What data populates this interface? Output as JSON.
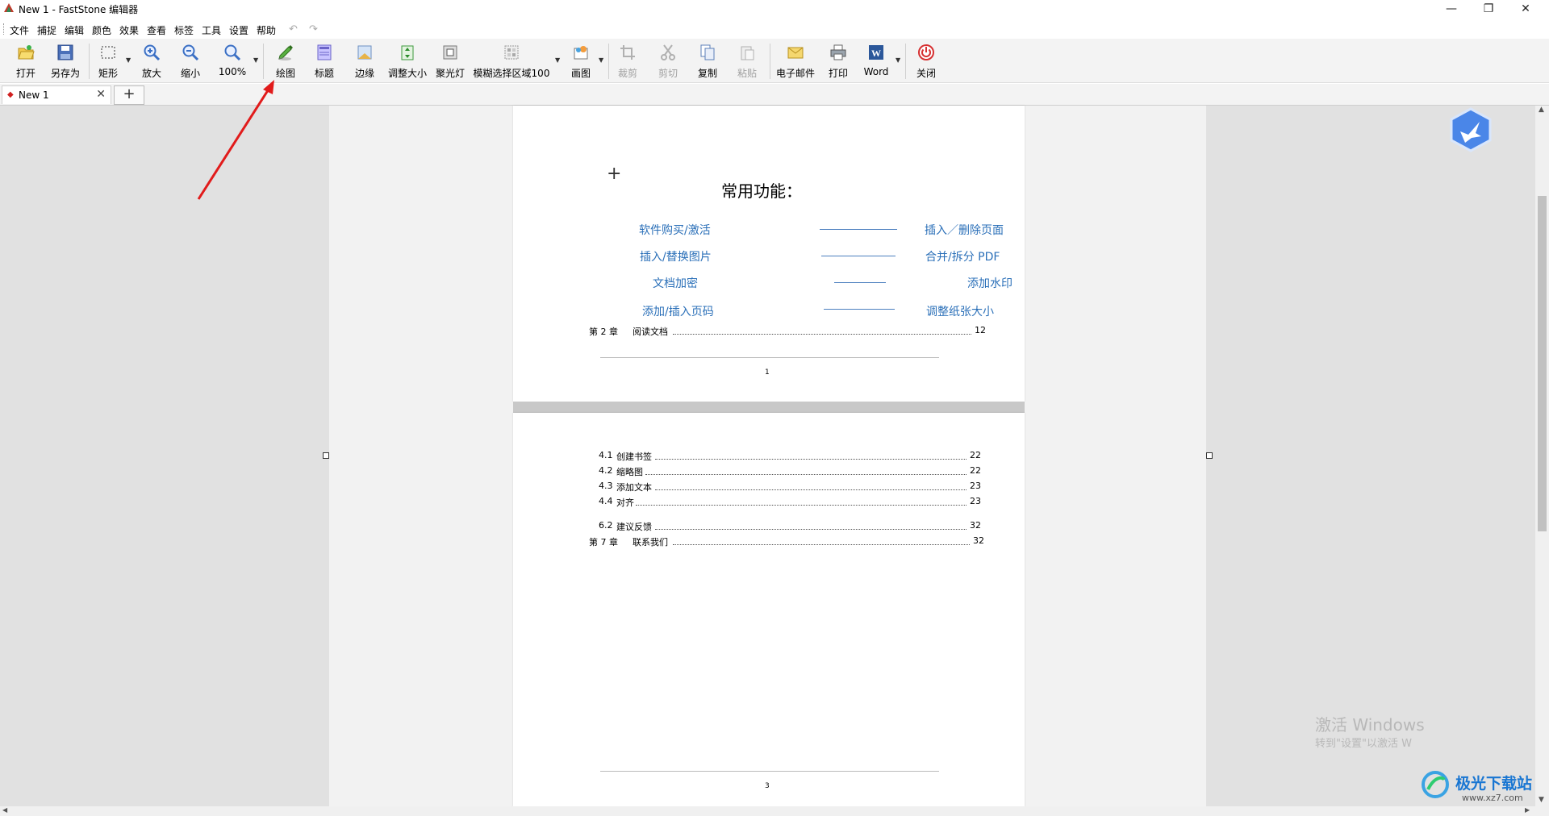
{
  "window": {
    "title": "New 1 - FastStone 编辑器",
    "minimize_icon": "minimize-icon",
    "restore_icon": "restore-icon",
    "close_icon": "close-icon"
  },
  "menu": [
    "文件",
    "捕捉",
    "编辑",
    "颜色",
    "效果",
    "查看",
    "标签",
    "工具",
    "设置",
    "帮助"
  ],
  "toolbar": {
    "open": "打开",
    "save_as": "另存为",
    "rect": "矩形",
    "zoom_in": "放大",
    "zoom_out": "缩小",
    "zoom_level": "100%",
    "draw": "绘图",
    "caption": "标题",
    "edge": "边缘",
    "resize": "调整大小",
    "spotlight": "聚光灯",
    "blur": "模糊选择区域100",
    "canvas": "画图",
    "crop": "裁剪",
    "cut": "剪切",
    "copy": "复制",
    "paste": "粘贴",
    "email": "电子邮件",
    "print": "打印",
    "word": "Word",
    "close": "关闭"
  },
  "tabs": [
    {
      "label": "New 1"
    }
  ],
  "page1": {
    "heading": "常用功能：",
    "left_links": [
      "软件购买/激活",
      "插入/替换图片",
      "文档加密",
      "添加/插入页码"
    ],
    "right_links": [
      "插入／删除页面",
      "合并/拆分  PDF",
      "添加水印",
      "调整纸张大小"
    ],
    "toc": {
      "num": "第 2 章",
      "title": "阅读文档",
      "page": "12"
    },
    "page_num": "1"
  },
  "page3": {
    "toc": [
      {
        "num": "4.1",
        "title": "创建书签",
        "page": "22"
      },
      {
        "num": "4.2",
        "title": "缩略图",
        "page": "22"
      },
      {
        "num": "4.3",
        "title": "添加文本",
        "page": "23"
      },
      {
        "num": "4.4",
        "title": "对齐",
        "page": "23"
      },
      {
        "num": "6.2",
        "title": "建议反馈",
        "page": "32"
      }
    ],
    "chapter": {
      "num": "第 7 章",
      "title": "联系我们",
      "page": "32"
    },
    "page_num": "3"
  },
  "watermark": {
    "line1": "激活 Windows",
    "line2": "转到\"设置\"以激活 W",
    "site": "极光下载站",
    "url": "www.xz7.com"
  },
  "colors": {
    "toolbar_bg": "#f3f3f3",
    "canvas_bg": "#e1e1e1",
    "link_blue": "#2a6fb8",
    "annotation_red": "#e11b1b"
  }
}
